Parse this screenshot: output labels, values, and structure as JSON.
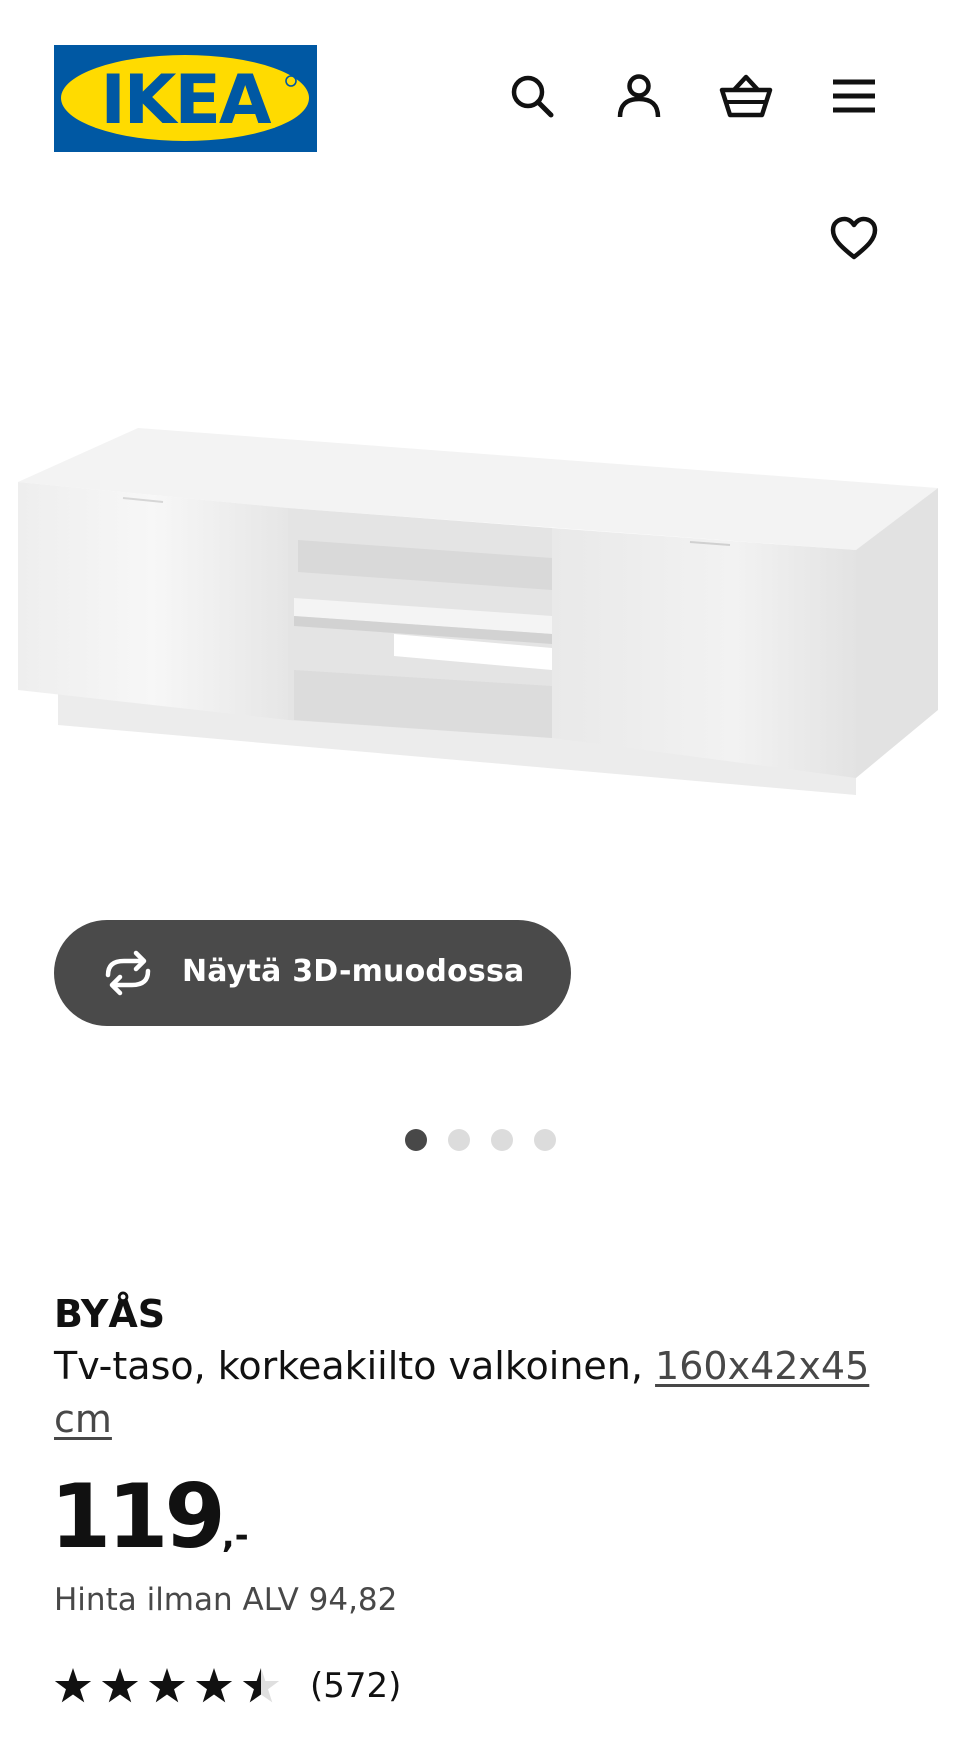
{
  "header": {
    "logo_text": "IKEA",
    "brand_colors": {
      "blue": "#0058a3",
      "yellow": "#ffdb00"
    },
    "icons": [
      "search-icon",
      "account-icon",
      "shopping-basket-icon",
      "hamburger-menu-icon"
    ]
  },
  "favourite": {
    "icon": "heart-icon"
  },
  "gallery": {
    "image_count": 4,
    "active_index": 0
  },
  "view_3d": {
    "label": "Näytä 3D-muodossa",
    "icon": "rotate-3d-icon"
  },
  "product": {
    "name": "BYÅS",
    "description": "Tv-taso, korkeakiilto valkoinen,",
    "measurements": "160x42x45 cm",
    "price_integer": "119",
    "price_suffix": ",-",
    "price_without_vat": "Hinta ilman ALV 94,82",
    "rating": {
      "stars": 4.5,
      "max": 5,
      "count_label": "(572)"
    }
  }
}
